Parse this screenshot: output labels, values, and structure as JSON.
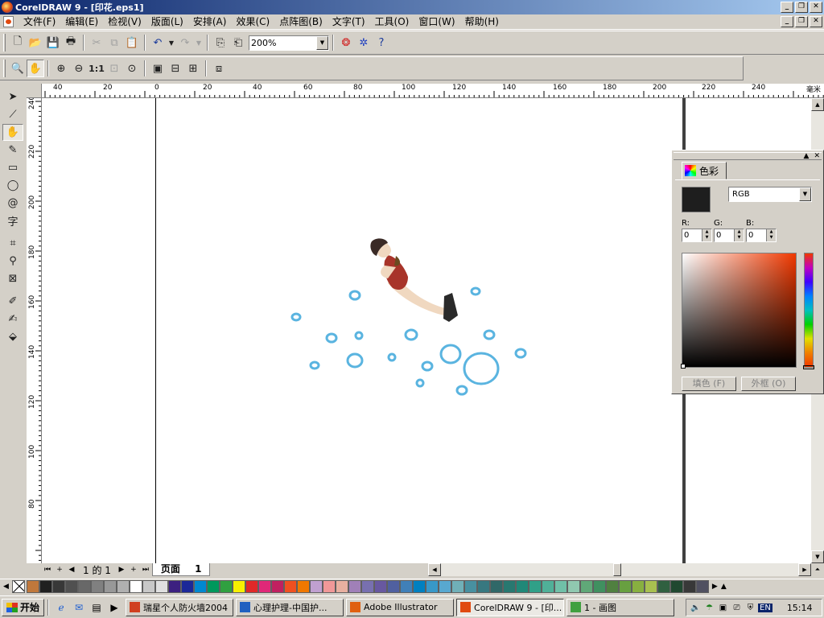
{
  "window": {
    "title": "CorelDRAW 9 - [印花.eps1]"
  },
  "menu": [
    "文件(F)",
    "编辑(E)",
    "检视(V)",
    "版面(L)",
    "安排(A)",
    "效果(C)",
    "点阵图(B)",
    "文字(T)",
    "工具(O)",
    "窗口(W)",
    "帮助(H)"
  ],
  "toolbar": {
    "zoom_value": "200%",
    "zoom_one": "1:1"
  },
  "ruler": {
    "unit": "毫米",
    "top_labels": [
      "40",
      "20",
      "0",
      "20",
      "40",
      "60",
      "80",
      "100",
      "120",
      "140",
      "160",
      "180",
      "200",
      "220",
      "240"
    ],
    "left_labels": [
      "240",
      "220",
      "200",
      "180",
      "160",
      "140",
      "120",
      "100",
      "80"
    ]
  },
  "pagebar": {
    "page_count": "1 的 1",
    "page_tab": "页面",
    "page_number": "1"
  },
  "docker": {
    "tab_label": "色彩",
    "color_model": "RGB",
    "channels": [
      {
        "label": "R:",
        "value": "0"
      },
      {
        "label": "G:",
        "value": "0"
      },
      {
        "label": "B:",
        "value": "0"
      }
    ],
    "fill_button": "填色 (F)",
    "outline_button": "外框 (O)",
    "current_color": "#1e1e1e"
  },
  "palette_colors": [
    "#c0783c",
    "#202020",
    "#383838",
    "#505050",
    "#686868",
    "#808080",
    "#989898",
    "#b0b0b0",
    "#ffffff",
    "#c8c8c8",
    "#e0e0e0",
    "#3c2080",
    "#1c2898",
    "#0088d0",
    "#00985c",
    "#30a040",
    "#f8f000",
    "#e02828",
    "#e02878",
    "#c02060",
    "#f05020",
    "#f07800",
    "#c0a0d0",
    "#f09898",
    "#e8b0a0",
    "#a080b8",
    "#7870b0",
    "#6858a0",
    "#5060a0",
    "#4080b8",
    "#0080c0",
    "#3898c8",
    "#58a8d0",
    "#70b0b8",
    "#4890a0",
    "#387880",
    "#306868",
    "#287870",
    "#208878",
    "#30a088",
    "#50b098",
    "#70c0a8",
    "#90c8b0",
    "#60a878",
    "#409060",
    "#508040",
    "#68a040",
    "#88b040",
    "#a8c050",
    "#306040",
    "#204830",
    "#383838",
    "#505060"
  ],
  "taskbar": {
    "start": "开始",
    "tasks": [
      {
        "label": "瑞星个人防火墙2004",
        "active": false,
        "icon_color": "#d04020"
      },
      {
        "label": "心理护理-中国护...",
        "active": false,
        "icon_color": "#2060c0"
      },
      {
        "label": "Adobe Illustrator",
        "active": false,
        "icon_color": "#e06010"
      },
      {
        "label": "CorelDRAW 9 - [印...",
        "active": true,
        "icon_color": "#e04a10"
      },
      {
        "label": "1 - 画图",
        "active": false,
        "icon_color": "#40a040"
      }
    ],
    "tray_lang": "EN",
    "clock": "15:14"
  }
}
